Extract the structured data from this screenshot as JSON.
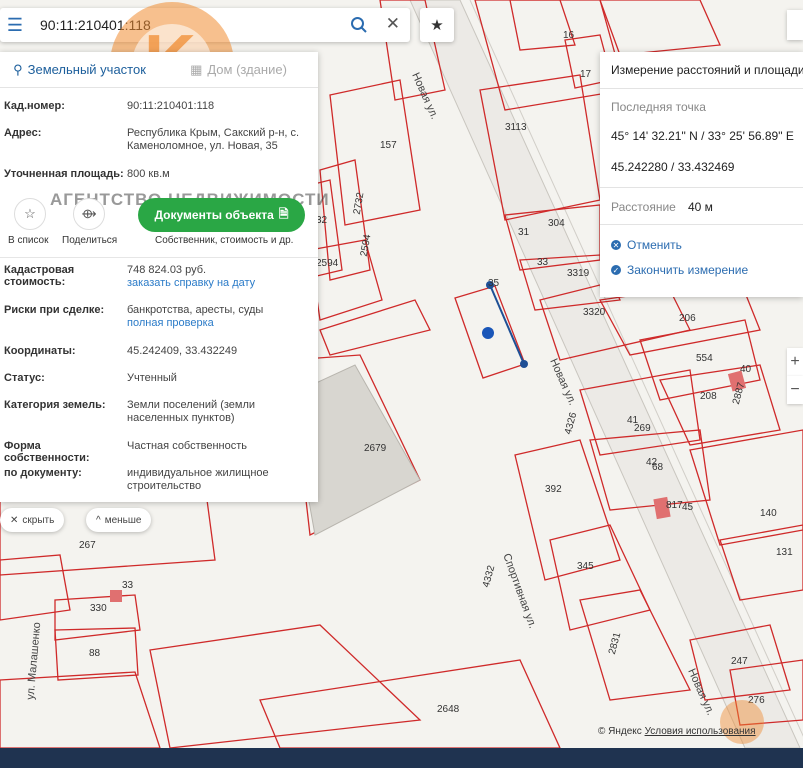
{
  "search": {
    "query": "90:11:210401:118"
  },
  "tabs": [
    {
      "label": "Земельный участок"
    },
    {
      "label": "Дом (здание)"
    }
  ],
  "watermark": "АГЕНТСТВО НЕДВИЖИМОСТИ",
  "info": {
    "cadastral_label": "Кад.номер:",
    "cadastral_value": "90:11:210401:118",
    "address_label": "Адрес:",
    "address_value": "Республика Крым, Сакский р-н, с. Каменоломное, ул. Новая, 35",
    "area_label": "Уточненная площадь:",
    "area_value": "800 кв.м"
  },
  "actions": {
    "list_label": "В список",
    "share_label": "Поделиться",
    "docs_button": "Документы объекта",
    "docs_sub": "Собственник, стоимость и др."
  },
  "details": {
    "cost_label": "Кадастровая стоимость:",
    "cost_value": "748 824.03 руб.",
    "cost_link": "заказать справку на дату",
    "risk_label": "Риски при сделке:",
    "risk_value": "банкротства, аресты, суды",
    "risk_link": "полная проверка",
    "coords_label": "Координаты:",
    "coords_value": "45.242409, 33.432249",
    "status_label": "Статус:",
    "status_value": "Учтенный",
    "category_label": "Категория земель:",
    "category_value": "Земли поселений (земли населенных пунктов)",
    "ownership_label": "Форма собственности:",
    "ownership_value": "Частная собственность",
    "document_label": "по документу:",
    "document_value": "индивидуальное жилищное строительство"
  },
  "pills": {
    "hide": "скрыть",
    "less": "меньше"
  },
  "measure": {
    "title": "Измерение расстояний и площади",
    "last_point_label": "Последняя точка",
    "dms": "45° 14' 32.21\" N / 33° 25' 56.89\" E",
    "decimal": "45.242280 / 33.432469",
    "distance_label": "Расстояние",
    "distance_value": "40 м",
    "cancel": "Отменить",
    "finish": "Закончить измерение"
  },
  "map_labels": {
    "p16": "16",
    "p17": "17",
    "p3113": "3113",
    "p157": "157",
    "p2732": "2732",
    "p2594": "2594",
    "p32": "32",
    "p2594b": "2594",
    "p304": "304",
    "p31": "31",
    "p33": "33",
    "p3319": "3319",
    "p3320": "3320",
    "p206": "206",
    "p554": "554",
    "p40": "40",
    "p2887": "2887",
    "p208": "208",
    "p41": "41",
    "p269": "269",
    "p42": "42",
    "p68": "68",
    "p2679": "2679",
    "p392": "392",
    "p817": "817",
    "p45": "45",
    "p140": "140",
    "p131": "131",
    "p267": "267",
    "p330": "330",
    "p33b": "33",
    "p88": "88",
    "p345": "345",
    "p2831": "2831",
    "p4332": "4332",
    "p4326": "4326",
    "p247": "247",
    "p276": "276",
    "p2648": "2648",
    "p35": "35"
  },
  "streets": {
    "novaya1": "Новая ул.",
    "novaya2": "Новая ул.",
    "novaya3": "Новая ул.",
    "sport": "Спортивная ул.",
    "malashenko": "ул. Малашенко"
  },
  "copyright": {
    "prefix": "© Яндекс",
    "terms": "Условия использования"
  },
  "colors": {
    "parcel_border": "#cf2a2a",
    "accent": "#2b6cb0",
    "green": "#2aa745",
    "measure_line": "#1e4f95"
  }
}
